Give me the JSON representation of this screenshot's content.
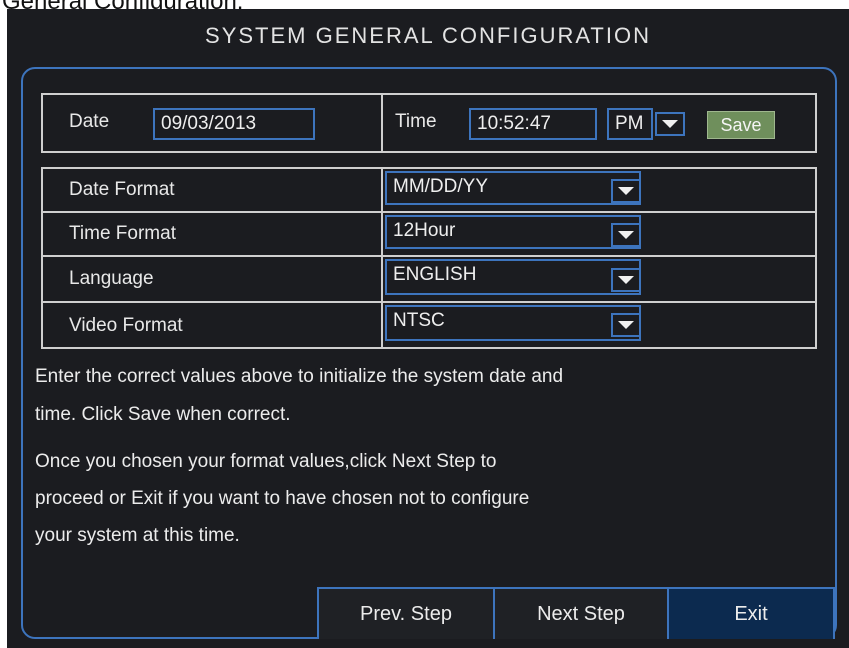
{
  "caption": "General Configuration:",
  "dialog": {
    "title": "SYSTEM GENERAL CONFIGURATION",
    "date": {
      "label": "Date",
      "value": "09/03/2013"
    },
    "time": {
      "label": "Time",
      "value": "10:52:47",
      "ampm": "PM",
      "save_label": "Save"
    },
    "settings": [
      {
        "label": "Date Format",
        "value": "MM/DD/YY"
      },
      {
        "label": "Time Format",
        "value": "12Hour"
      },
      {
        "label": "Language",
        "value": "ENGLISH"
      },
      {
        "label": "Video Format",
        "value": "NTSC"
      }
    ],
    "help_1_line_1": "Enter the correct values above to initialize the system date and",
    "help_1_line_2": "time. Click Save when correct.",
    "help_2_line_1": "Once you chosen your format values,click Next Step to",
    "help_2_line_2": "proceed or Exit if you want to have chosen not to configure",
    "help_2_line_3": "your system at this time.",
    "buttons": {
      "prev": "Prev. Step",
      "next": "Next Step",
      "exit": "Exit"
    }
  },
  "colors": {
    "accent": "#3d74bd",
    "save": "#6f8f5c",
    "background": "#1b1c20"
  }
}
